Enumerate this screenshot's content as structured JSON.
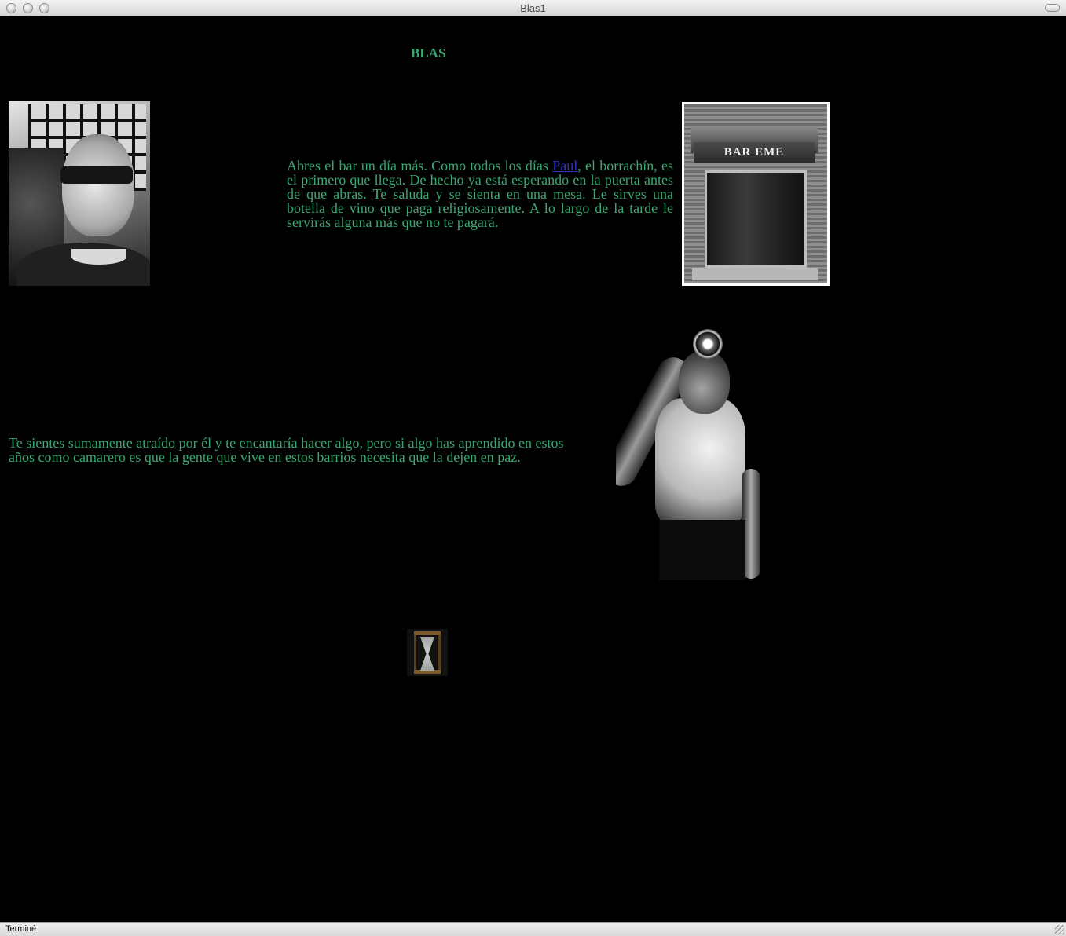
{
  "window": {
    "title": "Blas1"
  },
  "page": {
    "heading": "BLAS",
    "paragraph1": {
      "before_link": "Abres el bar un día más. Como todos los días ",
      "link_text": "Paul",
      "after_link": ", el borrachín, es el primero que llega. De hecho ya está esperando en la puerta antes de que abras. Te saluda y se sienta en una mesa. Le sirves una botella de vino que paga religiosamente. A lo largo de la tarde le servirás alguna más que no te pagará."
    },
    "paragraph2": "Te sientes sumamente atraído por él y te encantaría hacer algo, pero si algo has aprendido en estos años como camarero es que la gente que vive en estos barrios necesita que la dejen en paz.",
    "bar_sign": "BAR  EME",
    "colors": {
      "text": "#3aa872",
      "link": "#3333cc",
      "background": "#000000"
    }
  },
  "status": {
    "text": "Terminé"
  }
}
